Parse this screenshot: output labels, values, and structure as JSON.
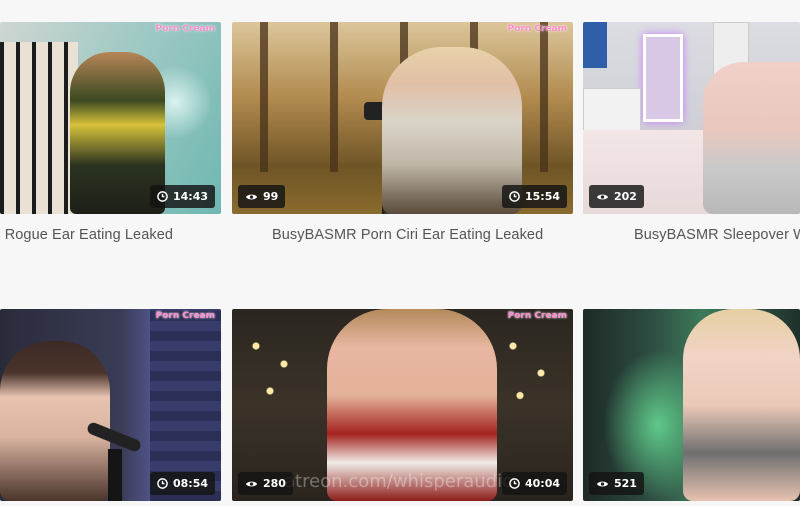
{
  "watermark": "Porn Cream",
  "videos": [
    {
      "title": "R Rogue Ear Eating Leaked",
      "views": "",
      "duration": "14:43"
    },
    {
      "title": "BusyBASMR Porn Ciri Ear Eating Leaked",
      "views": "99",
      "duration": "15:54"
    },
    {
      "title": "BusyBASMR Sleepover W",
      "views": "202",
      "duration": ""
    },
    {
      "title": "",
      "views": "",
      "duration": "08:54"
    },
    {
      "title": "",
      "views": "280",
      "duration": "40:04"
    },
    {
      "title": "",
      "views": "521",
      "duration": ""
    }
  ],
  "overlay_text": "atreon.com/whisperaudio",
  "icons": {
    "views": "eye-icon",
    "duration": "clock-icon"
  }
}
